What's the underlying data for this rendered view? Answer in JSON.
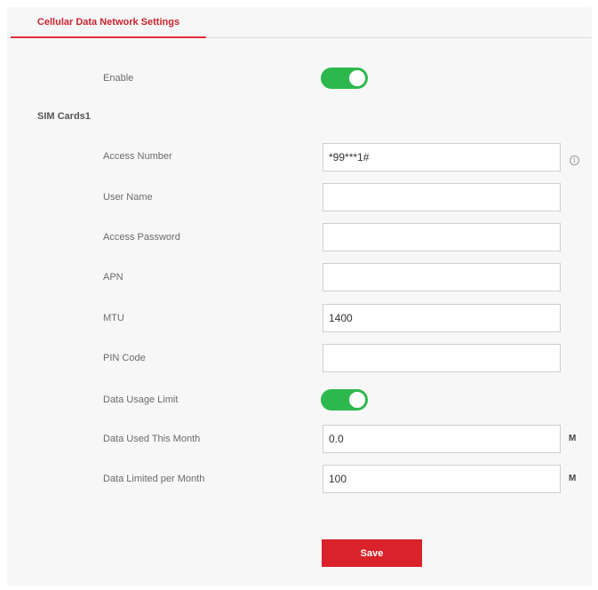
{
  "tab": {
    "label": "Cellular Data Network Settings"
  },
  "enable": {
    "label": "Enable",
    "on": true
  },
  "sim_section": {
    "title": "SIM Cards1"
  },
  "fields": {
    "access_number": {
      "label": "Access Number",
      "value": "*99***1#"
    },
    "user_name": {
      "label": "User Name",
      "value": ""
    },
    "access_password": {
      "label": "Access Password",
      "value": ""
    },
    "apn": {
      "label": "APN",
      "value": ""
    },
    "mtu": {
      "label": "MTU",
      "value": "1400"
    },
    "pin_code": {
      "label": "PIN Code",
      "value": ""
    },
    "data_usage_limit": {
      "label": "Data Usage Limit",
      "on": true
    },
    "data_used_this_month": {
      "label": "Data Used This Month",
      "value": "0.0",
      "unit": "M"
    },
    "data_limited_per_month": {
      "label": "Data Limited per Month",
      "value": "100",
      "unit": "M"
    }
  },
  "info_icon": {
    "glyph": "i",
    "icon": "info-icon"
  },
  "save": {
    "label": "Save"
  },
  "colors": {
    "accent_red": "#d9222a",
    "toggle_green": "#2db84d",
    "tab_text": "#c8232c"
  }
}
